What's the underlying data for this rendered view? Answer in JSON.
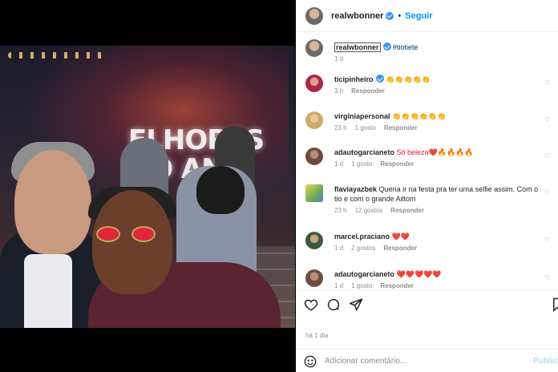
{
  "post": {
    "image_sign": "ELHORES\nDO ANO"
  },
  "header": {
    "username": "realwbonner",
    "separator": "•",
    "follow_label": "Seguir"
  },
  "caption": {
    "username": "realwbonner",
    "text": "#tiotiete",
    "time": "1 d"
  },
  "comments": [
    {
      "username": "ticipinheiro",
      "text": "👏👏👏👏👏",
      "time": "3 h",
      "likes": "",
      "reply": "Responder",
      "emoji_class": "emo"
    },
    {
      "username": "virginiapersonal",
      "text": "👏👏👏👏👏👏",
      "time": "23 h",
      "likes": "1 gosto",
      "reply": "Responder",
      "emoji_class": "emo"
    },
    {
      "username": "adautogarcianeto",
      "text": "Só beleza❤️🔥🔥🔥🔥",
      "time": "1 d",
      "likes": "1 gosto",
      "reply": "Responder",
      "emoji_class": "red"
    },
    {
      "username": "flaviayazbek",
      "text": "Queria ir na festa pra ter uma selfie assim. Com o tio e com o grande Ailtom",
      "time": "23 h",
      "likes": "12 gostos",
      "reply": "Responder",
      "emoji_class": ""
    },
    {
      "username": "marcel.praciano",
      "text": "❤️❤️",
      "time": "1 d",
      "likes": "2 gostos",
      "reply": "Responder",
      "emoji_class": "red"
    },
    {
      "username": "adautogarcianeto",
      "text": "❤️❤️❤️❤️❤️",
      "time": "1 d",
      "likes": "1 gosto",
      "reply": "Responder",
      "emoji_class": "red"
    }
  ],
  "footer": {
    "time_ago": "há 1 dia",
    "comment_placeholder": "Adicionar comentário...",
    "post_label": "Publicar"
  },
  "colors": {
    "link_blue": "#0095f6",
    "verified_blue": "#3897f0",
    "muted": "#8e8e8e"
  },
  "icons": [
    "heart-icon",
    "comment-icon",
    "share-icon",
    "save-icon",
    "emoji-icon",
    "verified-icon"
  ]
}
